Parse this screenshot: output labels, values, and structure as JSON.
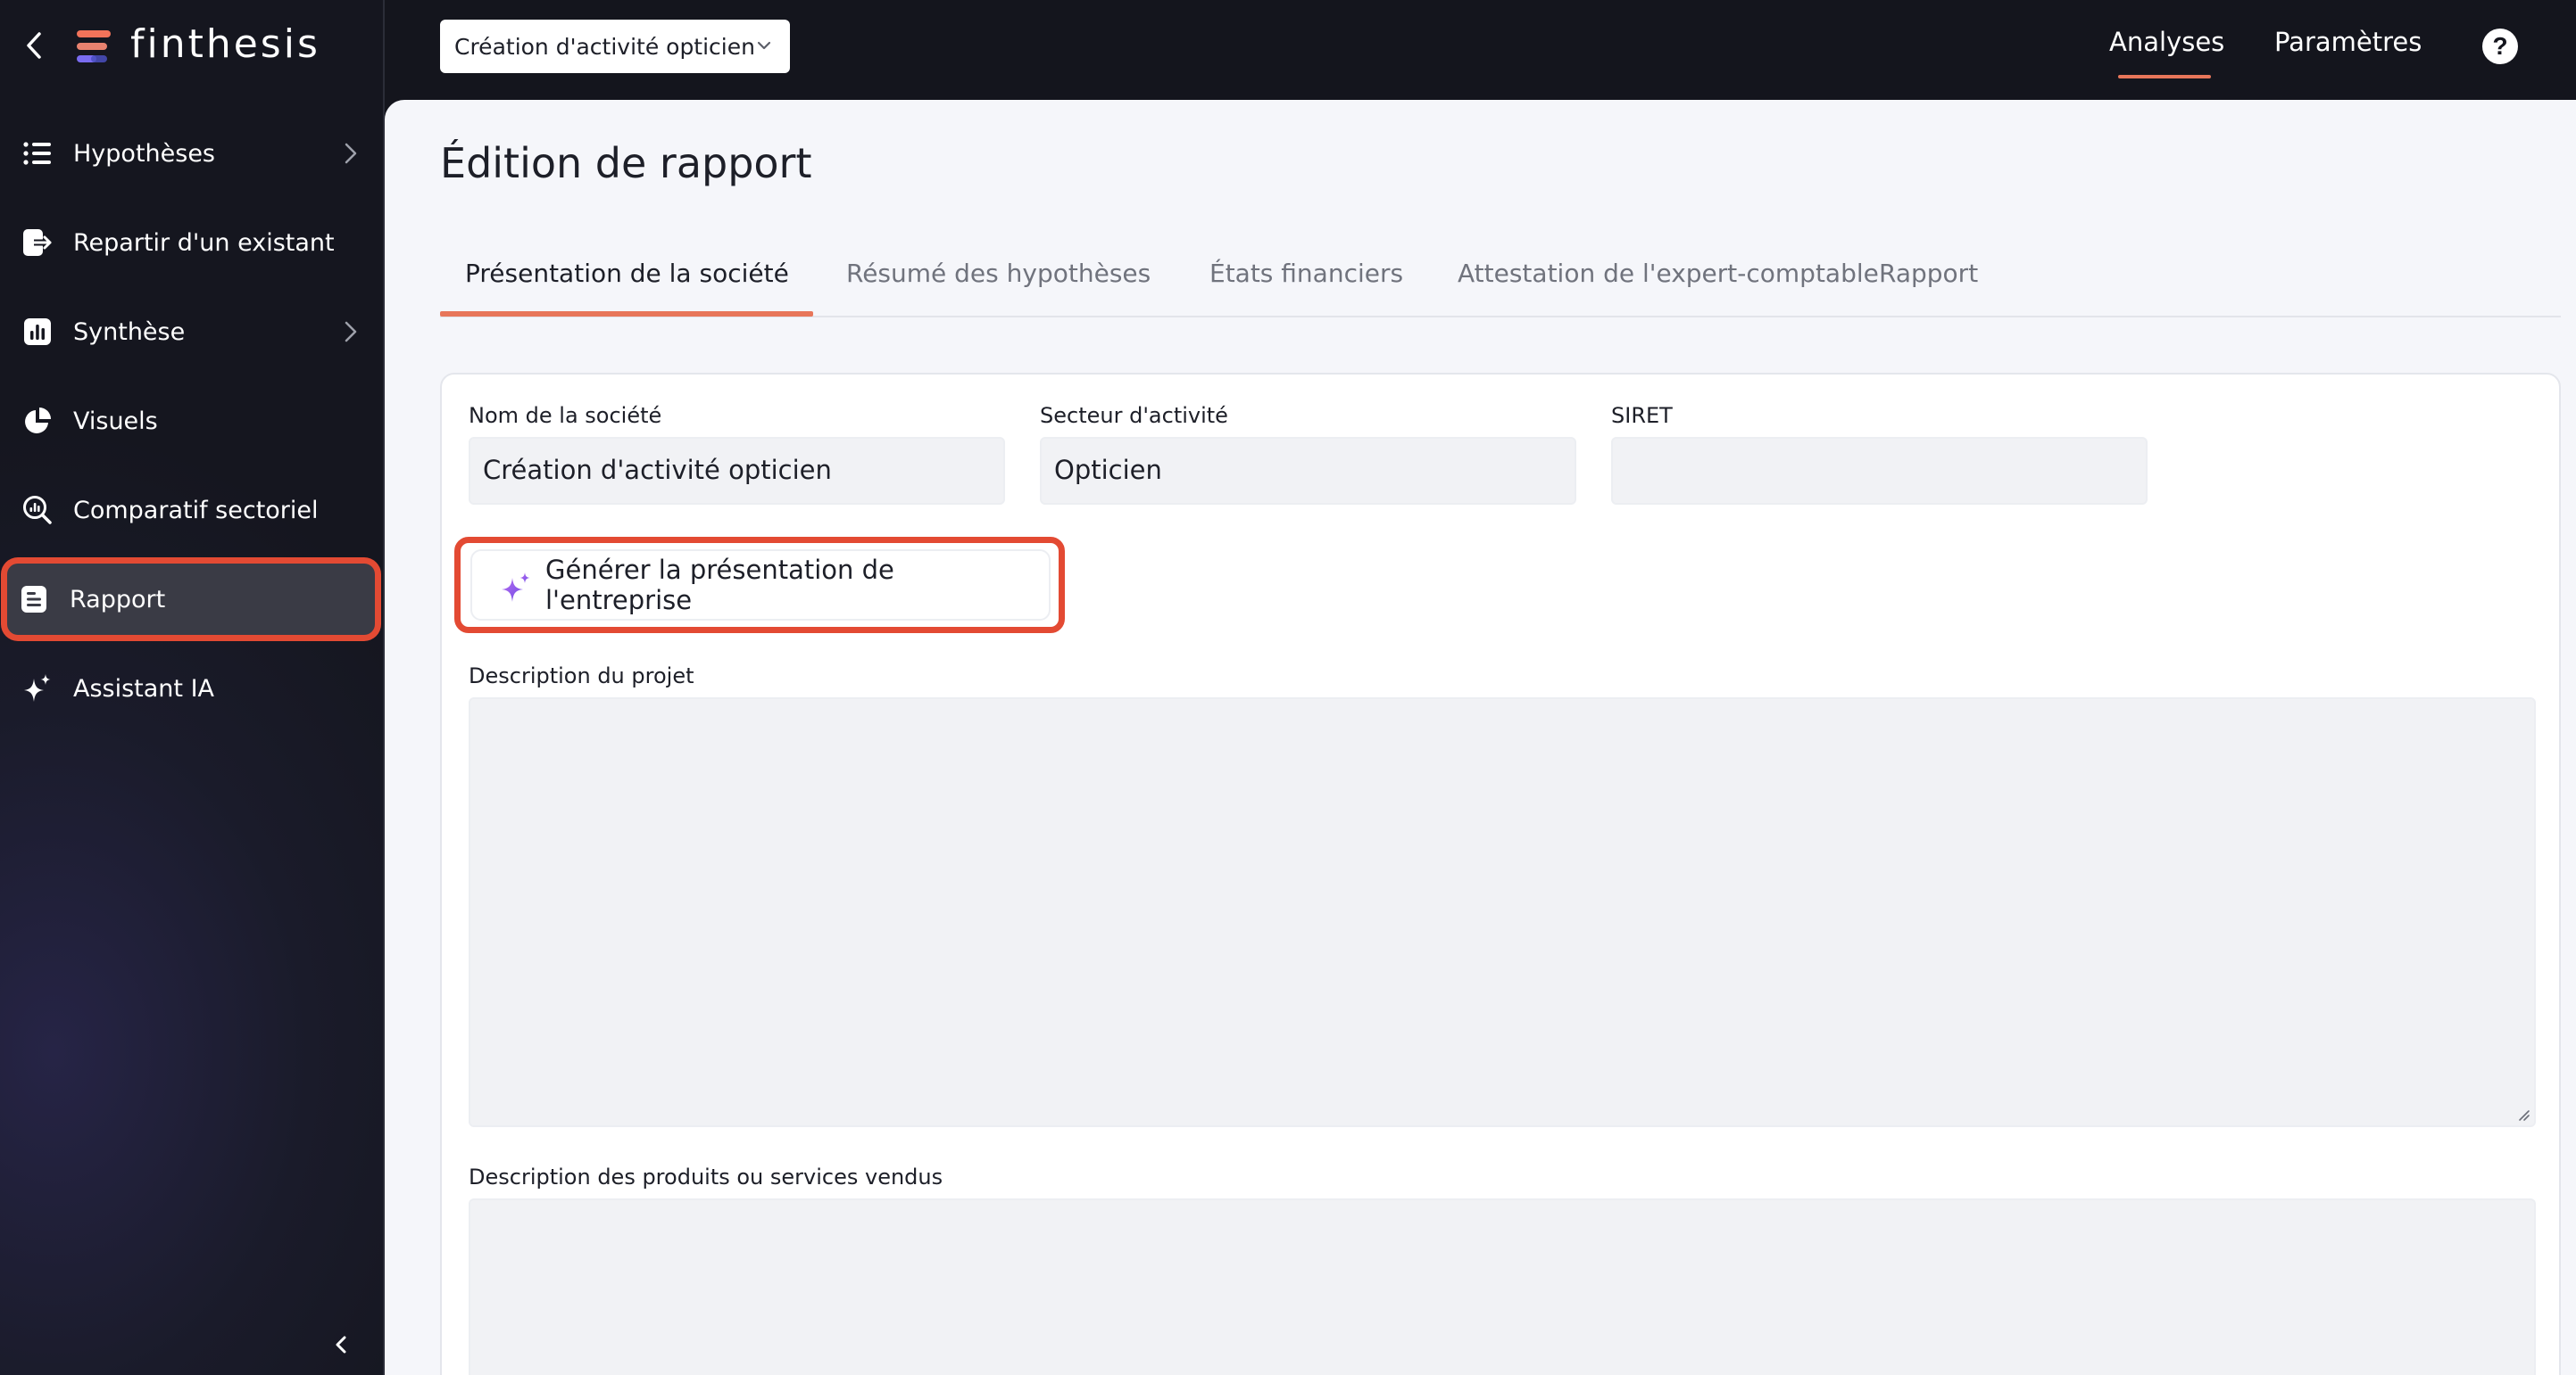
{
  "app": {
    "brand": "finthesis",
    "project_selector": "Création d'activité opticien"
  },
  "topnav": {
    "analyses": "Analyses",
    "parametres": "Paramètres",
    "help": "?"
  },
  "sidebar": {
    "items": [
      {
        "label": "Hypothèses",
        "icon": "list-icon",
        "has_chevron": true
      },
      {
        "label": "Repartir d'un existant",
        "icon": "import-icon",
        "has_chevron": false
      },
      {
        "label": "Synthèse",
        "icon": "bar-chart-icon",
        "has_chevron": true
      },
      {
        "label": "Visuels",
        "icon": "pie-chart-icon",
        "has_chevron": false
      },
      {
        "label": "Comparatif sectoriel",
        "icon": "search-chart-icon",
        "has_chevron": false
      },
      {
        "label": "Rapport",
        "icon": "document-icon",
        "has_chevron": false,
        "active": true
      },
      {
        "label": "Assistant IA",
        "icon": "sparkle-icon",
        "has_chevron": false
      }
    ]
  },
  "page": {
    "title": "Édition de rapport",
    "tabs": [
      {
        "label": "Présentation de la société",
        "active": true
      },
      {
        "label": "Résumé des hypothèses"
      },
      {
        "label": "États financiers"
      },
      {
        "label": "Attestation de l'expert-comptable"
      },
      {
        "label": "Rapport"
      }
    ]
  },
  "form": {
    "company_name_label": "Nom de la société",
    "company_name_value": "Création d'activité opticien",
    "sector_label": "Secteur d'activité",
    "sector_value": "Opticien",
    "siret_label": "SIRET",
    "siret_value": "",
    "generate_button": "Générer la présentation de l'entreprise",
    "project_description_label": "Description du projet",
    "products_description_label": "Description des produits ou services vendus"
  },
  "colors": {
    "accent": "#e8765a",
    "highlight": "#e34a33",
    "sidebar_bg": "#15161f",
    "sparkle": "#8b5cf6"
  }
}
